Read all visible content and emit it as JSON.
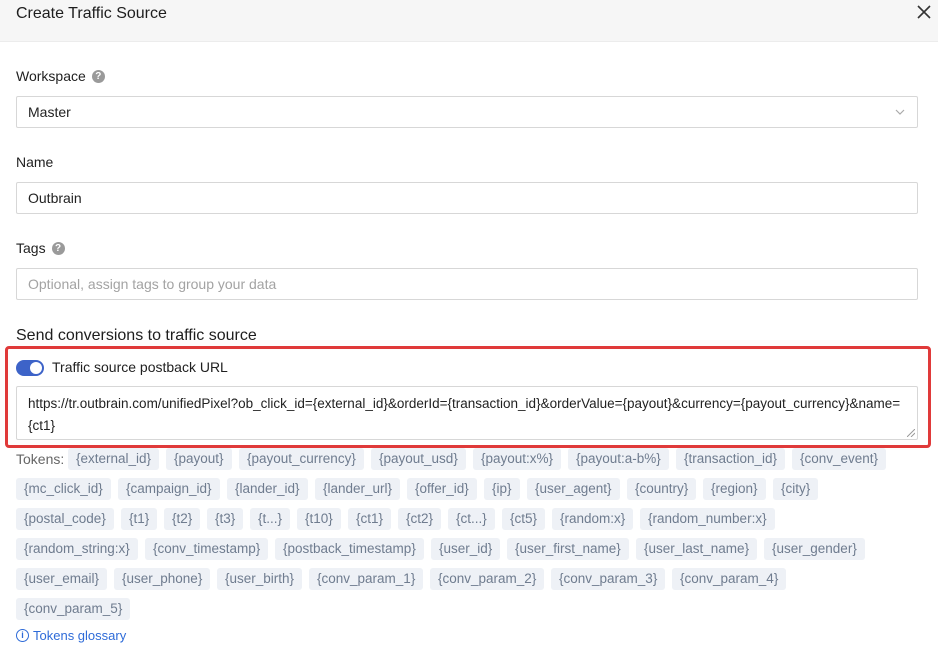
{
  "header": {
    "title": "Create Traffic Source"
  },
  "workspace": {
    "label": "Workspace",
    "value": "Master"
  },
  "name": {
    "label": "Name",
    "value": "Outbrain"
  },
  "tags": {
    "label": "Tags",
    "placeholder": "Optional, assign tags to group your data"
  },
  "conversions": {
    "section_title": "Send conversions to traffic source",
    "toggle_label": "Traffic source postback URL",
    "toggle_on": true,
    "url": "https://tr.outbrain.com/unifiedPixel?ob_click_id={external_id}&orderId={transaction_id}&orderValue={payout}&currency={payout_currency}&name={ct1}"
  },
  "tokens": {
    "label": "Tokens:",
    "items": [
      "{external_id}",
      "{payout}",
      "{payout_currency}",
      "{payout_usd}",
      "{payout:x%}",
      "{payout:a-b%}",
      "{transaction_id}",
      "{conv_event}",
      "{mc_click_id}",
      "{campaign_id}",
      "{lander_id}",
      "{lander_url}",
      "{offer_id}",
      "{ip}",
      "{user_agent}",
      "{country}",
      "{region}",
      "{city}",
      "{postal_code}",
      "{t1}",
      "{t2}",
      "{t3}",
      "{t...}",
      "{t10}",
      "{ct1}",
      "{ct2}",
      "{ct...}",
      "{ct5}",
      "{random:x}",
      "{random_number:x}",
      "{random_string:x}",
      "{conv_timestamp}",
      "{postback_timestamp}",
      "{user_id}",
      "{user_first_name}",
      "{user_last_name}",
      "{user_gender}",
      "{user_email}",
      "{user_phone}",
      "{user_birth}",
      "{conv_param_1}",
      "{conv_param_2}",
      "{conv_param_3}",
      "{conv_param_4}",
      "{conv_param_5}"
    ],
    "glossary_link": "Tokens glossary"
  },
  "colors": {
    "accent": "#3d63c8",
    "highlight": "#e03a3a",
    "chip_bg": "#eef1f6",
    "link": "#2e6bd8"
  },
  "icons": {
    "close": "close-icon",
    "help": "help-icon",
    "dropdown": "chevron-down-icon",
    "info": "info-icon"
  }
}
